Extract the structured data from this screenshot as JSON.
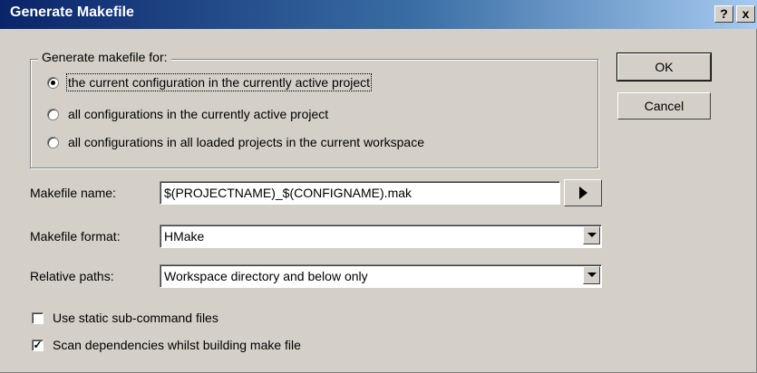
{
  "window": {
    "title": "Generate Makefile",
    "help_label": "?",
    "close_label": "x"
  },
  "group": {
    "legend": "Generate makefile for:",
    "options": [
      {
        "label": "the current configuration in the currently active project",
        "selected": true
      },
      {
        "label": "all configurations in the currently active project",
        "selected": false
      },
      {
        "label": "all configurations in all loaded projects in the current workspace",
        "selected": false
      }
    ]
  },
  "makefile_name": {
    "label": "Makefile name:",
    "value": "$(PROJECTNAME)_$(CONFIGNAME).mak"
  },
  "makefile_format": {
    "label": "Makefile format:",
    "value": "HMake"
  },
  "relative_paths": {
    "label": "Relative paths:",
    "value": "Workspace directory and below only"
  },
  "checks": [
    {
      "label": "Use static sub-command files",
      "checked": false
    },
    {
      "label": "Scan dependencies whilst building make file",
      "checked": true
    }
  ],
  "buttons": {
    "ok": "OK",
    "cancel": "Cancel"
  },
  "glyphs": {
    "check_mark": "✓"
  }
}
